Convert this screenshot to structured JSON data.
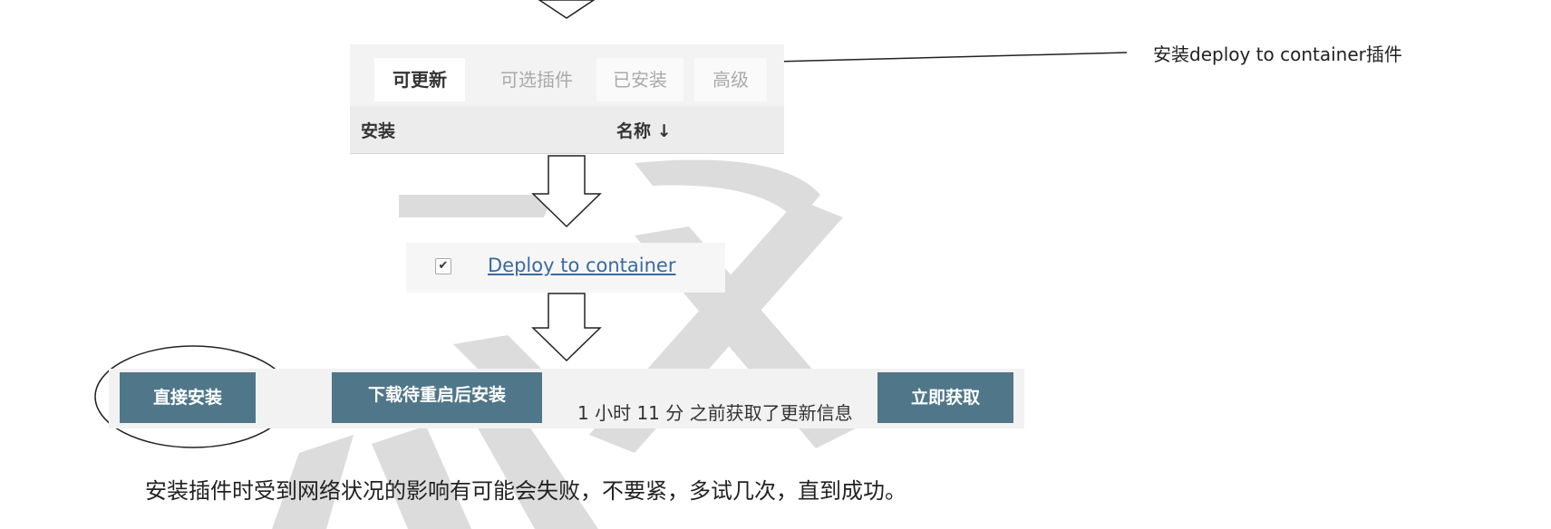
{
  "annotation": {
    "label": "安装deploy to container插件"
  },
  "tabs": [
    {
      "label": "可更新",
      "active": true
    },
    {
      "label": "可选插件",
      "active": false
    },
    {
      "label": "已安装",
      "active": false
    },
    {
      "label": "高级",
      "active": false
    }
  ],
  "table_header": {
    "install_col": "安装",
    "name_col": "名称 ↓"
  },
  "plugin": {
    "checked": true,
    "name": "Deploy to container"
  },
  "actions": {
    "install_now": "直接安装",
    "download_restart_install": "下载待重启后安装",
    "last_fetch_info": "1 小时 11 分 之前获取了更新信息",
    "fetch_now": "立即获取"
  },
  "note": "安装插件时受到网络状况的影响有可能会失败，不要紧，多试几次，直到成功。",
  "colors": {
    "button_bg": "#4f7789",
    "link": "#3a6aa0",
    "watermark": "#cfcfcf"
  }
}
